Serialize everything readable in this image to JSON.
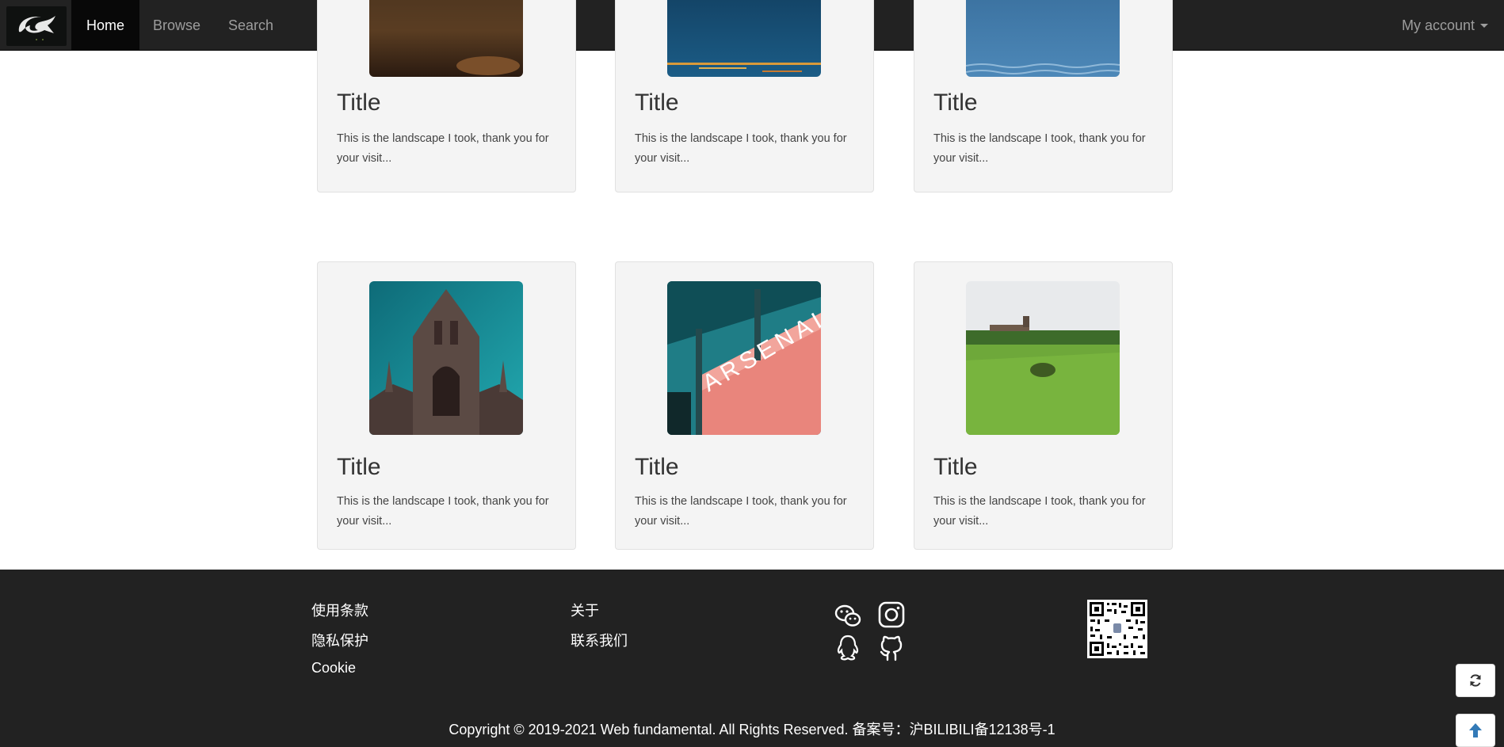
{
  "nav": {
    "brand_icon": "logo-icon",
    "items": [
      {
        "label": "Home",
        "active": true
      },
      {
        "label": "Browse",
        "active": false
      },
      {
        "label": "Search",
        "active": false
      }
    ],
    "account_label": "My account"
  },
  "cards": [
    {
      "title": "Title",
      "desc": "This is the landscape I took, thank you for your visit...",
      "image": "dusk-landscape"
    },
    {
      "title": "Title",
      "desc": "This is the landscape I took, thank you for your visit...",
      "image": "night-harbor"
    },
    {
      "title": "Title",
      "desc": "This is the landscape I took, thank you for your visit...",
      "image": "sea-water"
    },
    {
      "title": "Title",
      "desc": "This is the landscape I took, thank you for your visit...",
      "image": "gothic-church"
    },
    {
      "title": "Title",
      "desc": "This is the landscape I took, thank you for your visit...",
      "image": "arsenal-building"
    },
    {
      "title": "Title",
      "desc": "This is the landscape I took, thank you for your visit...",
      "image": "green-field"
    }
  ],
  "footer": {
    "col1": [
      "使用条款",
      "隐私保护",
      "Cookie"
    ],
    "col2": [
      "关于",
      "联系我们"
    ],
    "social_icons": [
      "wechat-icon",
      "instagram-icon",
      "qq-icon",
      "github-icon"
    ],
    "qr_icon": "qr-code-icon",
    "copyright": "Copyright © 2019-2021 Web fundamental. All Rights Reserved. 备案号：沪BILIBILI备12138号-1"
  },
  "floating": {
    "refresh_icon": "refresh-icon",
    "top_icon": "arrow-up-icon"
  },
  "colors": {
    "navbar_bg": "#222222",
    "nav_active_bg": "#080808",
    "card_bg": "#f4f4f4",
    "footer_bg": "#222222",
    "top_arrow": "#337ab7"
  }
}
